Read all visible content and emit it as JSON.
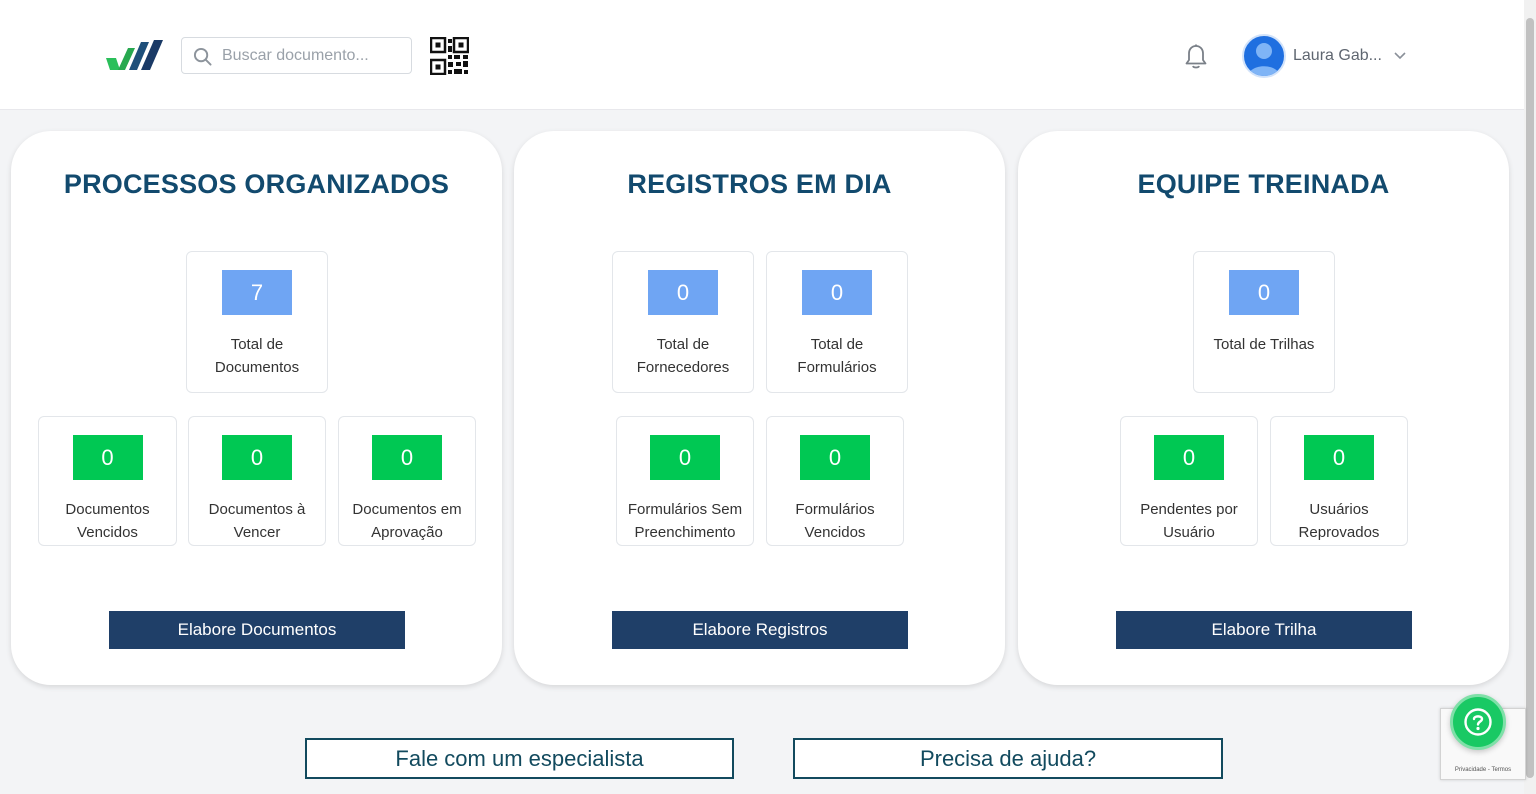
{
  "header": {
    "search_placeholder": "Buscar documento...",
    "user_name": "Laura Gab..."
  },
  "cards": {
    "processos": {
      "title": "PROCESSOS ORGANIZADOS",
      "total_documentos": {
        "value": "7",
        "label": "Total de\nDocumentos"
      },
      "documentos_vencidos": {
        "value": "0",
        "label": "Documentos\nVencidos"
      },
      "documentos_a_vencer": {
        "value": "0",
        "label": "Documentos à\nVencer"
      },
      "documentos_em_aprovacao": {
        "value": "0",
        "label": "Documentos em\nAprovação"
      },
      "button": "Elabore Documentos"
    },
    "registros": {
      "title": "REGISTROS EM DIA",
      "total_fornecedores": {
        "value": "0",
        "label": "Total de\nFornecedores"
      },
      "total_formularios": {
        "value": "0",
        "label": "Total de\nFormulários"
      },
      "formularios_sem_preenchimento": {
        "value": "0",
        "label": "Formulários Sem\nPreenchimento"
      },
      "formularios_vencidos": {
        "value": "0",
        "label": "Formulários\nVencidos"
      },
      "button": "Elabore Registros"
    },
    "equipe": {
      "title": "EQUIPE TREINADA",
      "total_trilhas": {
        "value": "0",
        "label": "Total de Trilhas"
      },
      "pendentes_por_usuario": {
        "value": "0",
        "label": "Pendentes por\nUsuário"
      },
      "usuarios_reprovados": {
        "value": "0",
        "label": "Usuários\nReprovados"
      },
      "button": "Elabore Trilha"
    }
  },
  "footer": {
    "especialista": "Fale com um especialista",
    "ajuda": "Precisa de ajuda?"
  },
  "recaptcha_text": "Privacidade - Termos",
  "colors": {
    "title": "#124a6e",
    "stat_blue": "#6fa5f3",
    "stat_green": "#00c853",
    "button_navy": "#1f3f68",
    "help_green": "#19c964"
  },
  "icons": [
    "logo",
    "search-icon",
    "qr-code-icon",
    "bell-icon",
    "user-avatar-icon",
    "chevron-down-icon",
    "help-question-icon"
  ]
}
